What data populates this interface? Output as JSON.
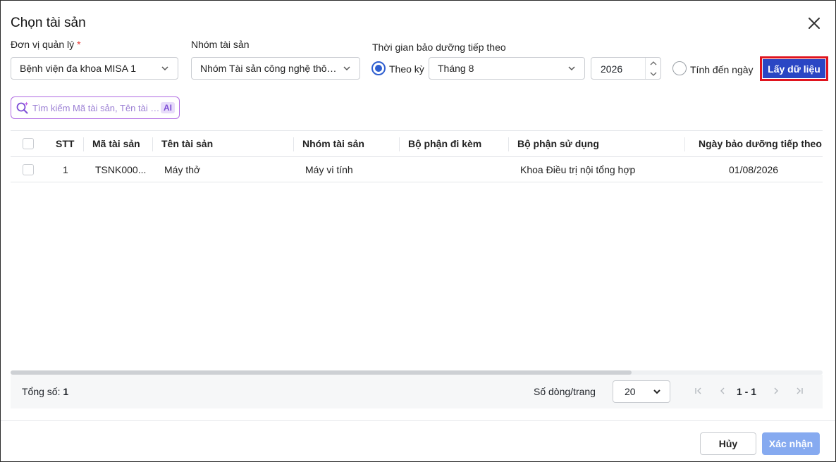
{
  "dialog": {
    "title": "Chọn tài sản"
  },
  "filters": {
    "unit": {
      "label": "Đơn vị quản lý",
      "required_mark": "*",
      "value": "Bệnh viện đa khoa MISA 1"
    },
    "group": {
      "label": "Nhóm tài sản",
      "value": "Nhóm Tài sản công nghệ thông tin"
    },
    "maintenance": {
      "label": "Thời gian bảo dưỡng tiếp theo",
      "by_period_label": "Theo kỳ",
      "by_period_selected": true,
      "month_value": "Tháng 8",
      "year_value": "2026",
      "until_date_label": "Tính đến ngày",
      "until_date_selected": false
    },
    "fetch_button": "Lấy dữ liệu"
  },
  "search": {
    "placeholder": "Tìm kiếm Mã tài sản, Tên tài sản",
    "ai_badge": "AI"
  },
  "table": {
    "columns": [
      "STT",
      "Mã tài sản",
      "Tên tài sản",
      "Nhóm tài sản",
      "Bộ phận đi kèm",
      "Bộ phận sử dụng",
      "Ngày bảo dưỡng tiếp theo"
    ],
    "rows": [
      {
        "stt": "1",
        "code": "TSNK000...",
        "name": "Máy thở",
        "group": "Máy vi tính",
        "accessory": "",
        "department": "Khoa Điều trị nội tổng hợp",
        "next_date": "01/08/2026"
      }
    ]
  },
  "footer": {
    "total_label": "Tổng số:",
    "total_value": "1",
    "rows_per_page_label": "Số dòng/trang",
    "rows_per_page": "20",
    "page_range": "1 - 1"
  },
  "actions": {
    "cancel": "Hủy",
    "confirm": "Xác nhận"
  },
  "colors": {
    "primary": "#2a46c4",
    "highlight_border": "#e0141e",
    "confirm_disabled": "#86aaf0",
    "ai_accent": "#b06be3"
  }
}
